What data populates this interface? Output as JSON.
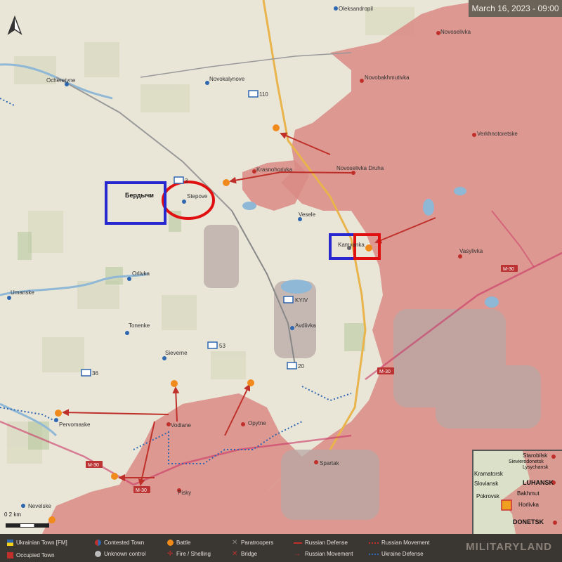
{
  "header": {
    "date": "March 16, 2023 - 09:00"
  },
  "map": {
    "towns": {
      "oleksandropil": "Oleksandropil",
      "novoselivka": "Novoselivka",
      "novobakhmutivka": "Novobakhmutivka",
      "verkhnotoretske": "Verkhnotoretske",
      "ocheretyne": "Ocheretyne",
      "novokalynove": "Novokalynove",
      "krasnohorivka": "Krasnohorivka",
      "novoselivka_druha": "Novoselivka Druha",
      "stepove": "Stepove",
      "berdychi": "Бердычи",
      "vesele": "Vesele",
      "kamyanka": "Kamyanka",
      "vasylivka": "Vasylivka",
      "orlivka": "Orlivka",
      "umanske": "Umanske",
      "tonenke": "Tonenke",
      "sieverne": "Sieverne",
      "avdiivka": "Avdiivka",
      "pervomaske": "Pervomaske",
      "vodiane": "Vodiane",
      "opytne": "Opytne",
      "spartak": "Spartak",
      "pisky": "Pisky",
      "nevelske": "Nevelske"
    },
    "units": {
      "u110": "110",
      "u3": "3",
      "u53": "53",
      "u36": "36",
      "u20": "20",
      "kyiv": "KYIV"
    },
    "roads": {
      "m30_a": "M-30",
      "m30_b": "M-30",
      "m30_c": "M-30",
      "m30_d": "M-30"
    },
    "scale_label": "0          2 km"
  },
  "inset": {
    "starobilsk": "Starobilsk",
    "sievierodonetsk": "Sievierodonetsk",
    "lysychansk": "Lysychansk",
    "kramatorsk": "Kramatorsk",
    "luhansk": "LUHANSK",
    "sloviansk": "Sloviansk",
    "bakhmut": "Bakhmut",
    "pokrovsk": "Pokrovsk",
    "horlivka": "Horlivka",
    "donetsk": "DONETSK"
  },
  "legend": {
    "ukrainian_town": "Ukrainian Town [FM]",
    "occupied_town": "Occupied Town",
    "contested_town": "Contested Town",
    "unknown_control": "Unknown control",
    "battle": "Battle",
    "fire_shelling": "Fire / Shelling",
    "paratroopers": "Paratroopers",
    "bridge": "Bridge",
    "russian_defense": "Russian Defense",
    "russian_movement": "Russian Movement",
    "russian_movement_2": "Russian Movement",
    "ukraine_defense": "Ukraine Defense",
    "brand": "MILITARYLAND"
  },
  "colors": {
    "occupied": "#d98a85",
    "land": "#e9e6d8",
    "water": "#8fb7d6",
    "russian": "#c0302b",
    "ukrainian": "#2f66b0",
    "highlight_red": "#e01010",
    "highlight_blue": "#2828d0"
  }
}
